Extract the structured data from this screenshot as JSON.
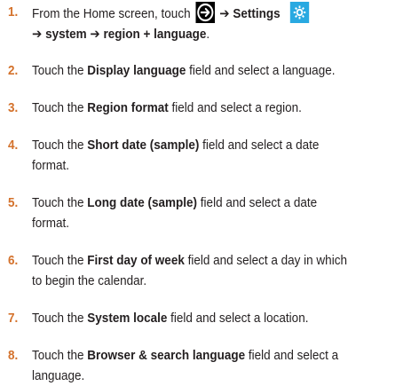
{
  "steps": [
    {
      "num": "1.",
      "line1_pre": "From the Home screen, touch",
      "arrow": "➔",
      "settings": "Settings",
      "line2_arrow1": "➔",
      "system": "system",
      "line2_arrow2": "➔",
      "region_language": "region + language",
      "end": "."
    },
    {
      "num": "2.",
      "pre": "Touch the ",
      "bold": "Display language",
      "post": " field and select a language."
    },
    {
      "num": "3.",
      "pre": "Touch the ",
      "bold": "Region format",
      "post": " field and select a region."
    },
    {
      "num": "4.",
      "pre": "Touch the ",
      "bold": "Short date (sample)",
      "post": " field and select a date",
      "line2": "format."
    },
    {
      "num": "5.",
      "pre": "Touch the ",
      "bold": "Long date (sample)",
      "post": " field and select a date",
      "line2": "format."
    },
    {
      "num": "6.",
      "pre": "Touch the ",
      "bold": "First day of week",
      "post": " field and select a day in which",
      "line2": "to begin the calendar."
    },
    {
      "num": "7.",
      "pre": "Touch the ",
      "bold": "System locale",
      "post": " field and select a location."
    },
    {
      "num": "8.",
      "pre": "Touch the ",
      "bold": "Browser & search language",
      "post": " field and select a",
      "line2": "language."
    }
  ],
  "icons": {
    "go_icon": "go-arrow-icon",
    "settings_icon": "gear-icon",
    "accent": "#d4722c",
    "settings_tile": "#29a9e1"
  }
}
